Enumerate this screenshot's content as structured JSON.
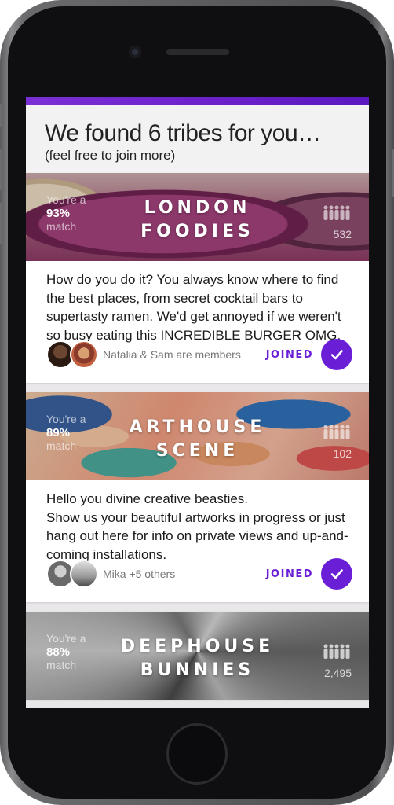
{
  "header": {
    "title": "We found 6 tribes for you…",
    "subtitle": "(feel free to join more)"
  },
  "colors": {
    "accent": "#6a1fd6",
    "topbar": "#7b2fd6"
  },
  "tribes": [
    {
      "name_line1": "LONDON",
      "name_line2": "FOODIES",
      "match_prefix": "You're a",
      "match_pct": "93%",
      "match_suffix": "match",
      "member_count": "532",
      "description": "How do you do it? You always know where to find the best places, from secret cocktail bars to supertasty ramen. We'd get annoyed if we weren't so busy eating this INCREDIBLE BURGER OMG.",
      "members_text": "Natalia & Sam are members",
      "status": "JOINED"
    },
    {
      "name_line1": "ARTHOUSE",
      "name_line2": "SCENE",
      "match_prefix": "You're a",
      "match_pct": "89%",
      "match_suffix": "match",
      "member_count": "102",
      "description": "Hello you divine creative beasties.\nShow us your beautiful artworks in progress or just hang out here for info on private views and up-and-coming installations.",
      "members_text": "Mika +5 others",
      "status": "JOINED"
    },
    {
      "name_line1": "DEEPHOUSE",
      "name_line2": "BUNNIES",
      "match_prefix": "You're a",
      "match_pct": "88%",
      "match_suffix": "match",
      "member_count": "2,495"
    }
  ]
}
